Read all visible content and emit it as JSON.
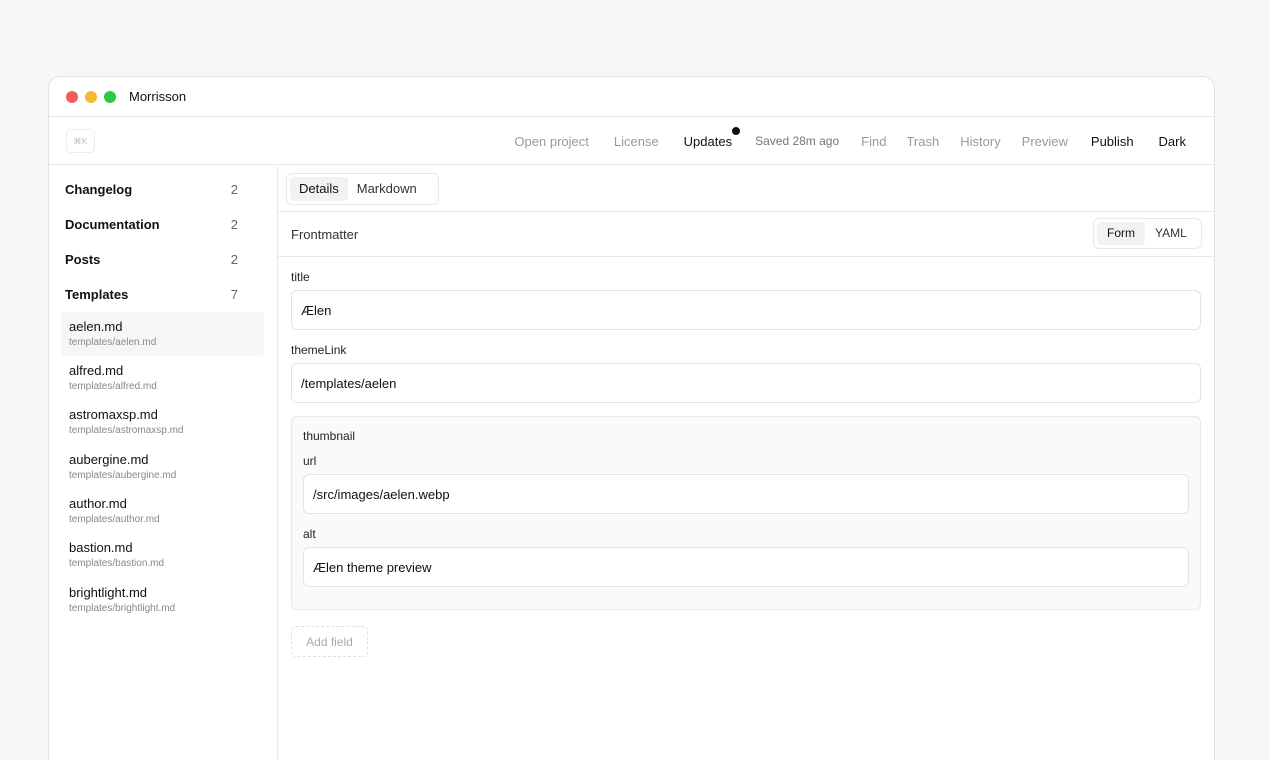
{
  "window": {
    "title": "Morrisson"
  },
  "toolbar": {
    "shortcut": "⌘K",
    "open_project": "Open project",
    "license": "License",
    "updates": "Updates",
    "saved": "Saved 28m ago",
    "find": "Find",
    "trash": "Trash",
    "history": "History",
    "preview": "Preview",
    "publish": "Publish",
    "theme": "Dark"
  },
  "sidebar": {
    "collections": [
      {
        "name": "Changelog",
        "count": "2"
      },
      {
        "name": "Documentation",
        "count": "2"
      },
      {
        "name": "Posts",
        "count": "2"
      },
      {
        "name": "Templates",
        "count": "7"
      }
    ],
    "files": [
      {
        "name": "aelen.md",
        "path": "templates/aelen.md",
        "active": true
      },
      {
        "name": "alfred.md",
        "path": "templates/alfred.md"
      },
      {
        "name": "astromaxsp.md",
        "path": "templates/astromaxsp.md"
      },
      {
        "name": "aubergine.md",
        "path": "templates/aubergine.md"
      },
      {
        "name": "author.md",
        "path": "templates/author.md"
      },
      {
        "name": "bastion.md",
        "path": "templates/bastion.md"
      },
      {
        "name": "brightlight.md",
        "path": "templates/brightlight.md"
      }
    ]
  },
  "editor": {
    "tabs": [
      "Details",
      "Markdown"
    ],
    "active_tab": "Details",
    "section_label": "Frontmatter",
    "modes": [
      "Form",
      "YAML"
    ],
    "active_mode": "Form",
    "fields": {
      "title": {
        "label": "title",
        "value": "Ælen"
      },
      "themeLink": {
        "label": "themeLink",
        "value": "/templates/aelen"
      },
      "thumbnail": {
        "label": "thumbnail",
        "url": {
          "label": "url",
          "value": "/src/images/aelen.webp"
        },
        "alt": {
          "label": "alt",
          "value": "Ælen theme preview"
        }
      }
    },
    "add_field": "Add field"
  }
}
